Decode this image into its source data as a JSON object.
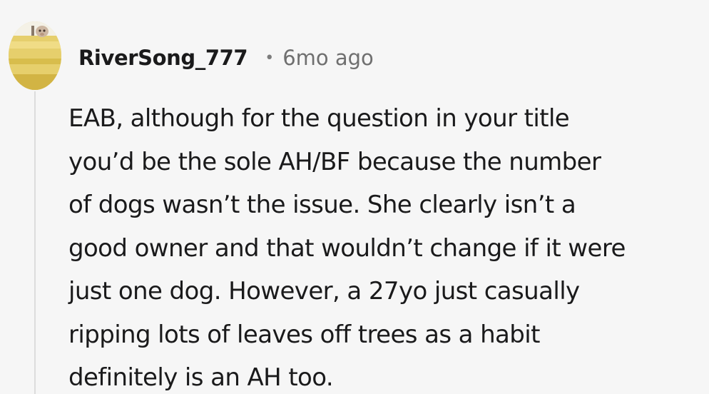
{
  "comment": {
    "username": "RiverSong_777",
    "separator": "•",
    "timestamp": "6mo ago",
    "lines": [
      "EAB, although for the question in your title",
      "you’d be the sole AH/BF because the number",
      "of dogs wasn’t the issue. She clearly isn’t a",
      "good owner and that wouldn’t change if it were",
      "just one dog. However, a 27yo just casually",
      "ripping lots of leaves off trees as a habit",
      "definitely is an AH too."
    ]
  }
}
